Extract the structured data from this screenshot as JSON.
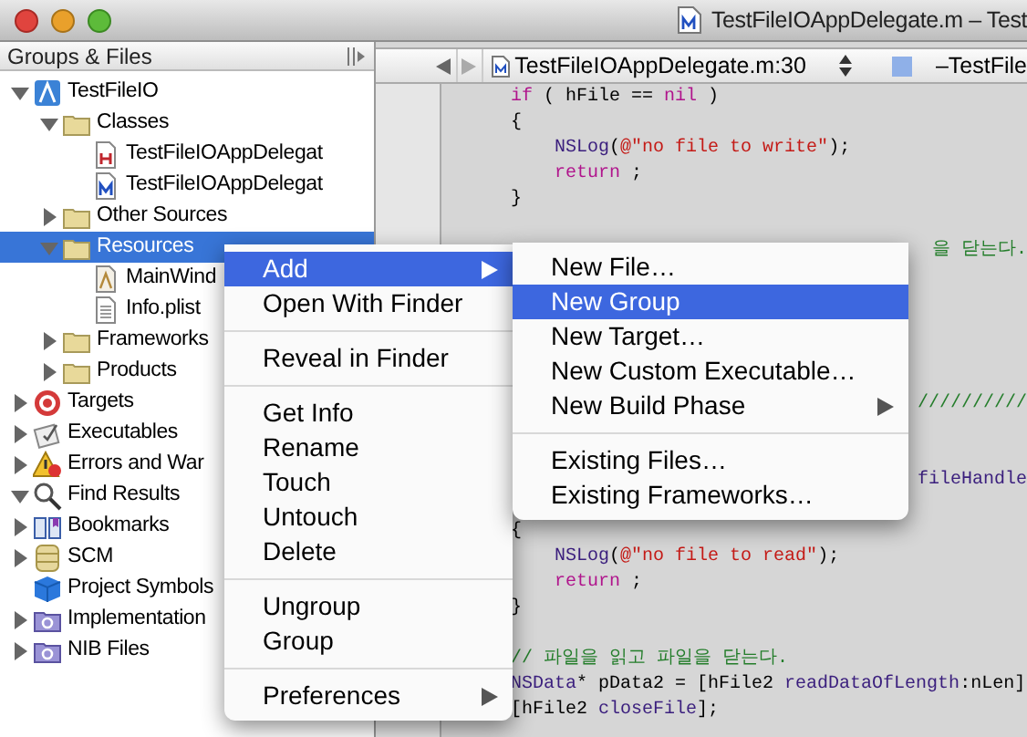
{
  "window": {
    "title": "TestFileIOAppDelegate.m – Test"
  },
  "sidebar": {
    "header": "Groups & Files",
    "items": [
      {
        "label": "TestFileIO",
        "kind": "project",
        "expanded": true,
        "selected": false,
        "children": [
          {
            "label": "Classes",
            "kind": "folder",
            "expanded": true,
            "selected": false,
            "children": [
              {
                "label": "TestFileIOAppDelegat",
                "kind": "h-file",
                "selected": false
              },
              {
                "label": "TestFileIOAppDelegat",
                "kind": "m-file",
                "selected": false
              }
            ]
          },
          {
            "label": "Other Sources",
            "kind": "folder",
            "expanded": false,
            "selected": false
          },
          {
            "label": "Resources",
            "kind": "folder",
            "expanded": true,
            "selected": true,
            "children": [
              {
                "label": "MainWind",
                "kind": "nib",
                "selected": false
              },
              {
                "label": "Info.plist",
                "kind": "plist",
                "selected": false
              }
            ]
          },
          {
            "label": "Frameworks",
            "kind": "folder",
            "expanded": false,
            "selected": false
          },
          {
            "label": "Products",
            "kind": "folder",
            "expanded": false,
            "selected": false
          }
        ]
      },
      {
        "label": "Targets",
        "kind": "target",
        "expanded": false,
        "selected": false
      },
      {
        "label": "Executables",
        "kind": "executable",
        "expanded": false,
        "selected": false
      },
      {
        "label": "Errors and War",
        "kind": "warning",
        "expanded": false,
        "selected": false
      },
      {
        "label": "Find Results",
        "kind": "find",
        "expanded": true,
        "selected": false
      },
      {
        "label": "Bookmarks",
        "kind": "bookmark",
        "expanded": false,
        "selected": false
      },
      {
        "label": "SCM",
        "kind": "scm",
        "expanded": false,
        "selected": false
      },
      {
        "label": "Project Symbols",
        "kind": "symbols",
        "selected": false
      },
      {
        "label": "Implementation",
        "kind": "smart-folder",
        "expanded": false,
        "selected": false
      },
      {
        "label": "NIB Files",
        "kind": "smart-folder",
        "expanded": false,
        "selected": false
      }
    ]
  },
  "navigation_bar": {
    "file": "TestFileIOAppDelegate.m:30",
    "symbol": "–TestFile"
  },
  "code_lines": [
    {
      "kind": "code",
      "segments": [
        {
          "kind": "keyword",
          "text": "if"
        },
        {
          "kind": "plain",
          "text": " ( hFile == "
        },
        {
          "kind": "keyword",
          "text": "nil"
        },
        {
          "kind": "plain",
          "text": " )"
        }
      ]
    },
    {
      "kind": "code",
      "segments": [
        {
          "kind": "plain",
          "text": "{"
        }
      ],
      "children": [
        {
          "kind": "code",
          "segments": [
            {
              "kind": "function",
              "text": "NSLog"
            },
            {
              "kind": "plain",
              "text": "("
            },
            {
              "kind": "string",
              "text": "@\"no file to write\""
            },
            {
              "kind": "plain",
              "text": ");"
            }
          ]
        },
        {
          "kind": "code",
          "segments": [
            {
              "kind": "keyword",
              "text": "return"
            },
            {
              "kind": "plain",
              "text": " ;"
            }
          ]
        }
      ]
    },
    {
      "kind": "code",
      "segments": [
        {
          "kind": "plain",
          "text": "}"
        }
      ]
    },
    {
      "kind": "blank"
    },
    {
      "kind": "partial",
      "segments": [
        {
          "kind": "comment",
          "text": "을 닫는다."
        }
      ]
    },
    {
      "kind": "blank"
    },
    {
      "kind": "blank"
    },
    {
      "kind": "blank"
    },
    {
      "kind": "blank"
    },
    {
      "kind": "blank"
    },
    {
      "kind": "partial",
      "segments": [
        {
          "kind": "comment",
          "text": "//////////"
        }
      ]
    },
    {
      "kind": "blank"
    },
    {
      "kind": "blank"
    },
    {
      "kind": "partial",
      "segments": [
        {
          "kind": "function",
          "text": "fileHandle"
        }
      ]
    },
    {
      "kind": "blank"
    },
    {
      "kind": "code",
      "segments": [
        {
          "kind": "plain",
          "text": "{"
        }
      ],
      "children": [
        {
          "kind": "code",
          "segments": [
            {
              "kind": "function",
              "text": "NSLog"
            },
            {
              "kind": "plain",
              "text": "("
            },
            {
              "kind": "string",
              "text": "@\"no file to read\""
            },
            {
              "kind": "plain",
              "text": ");"
            }
          ]
        },
        {
          "kind": "code",
          "segments": [
            {
              "kind": "keyword",
              "text": "return"
            },
            {
              "kind": "plain",
              "text": " ;"
            }
          ]
        }
      ]
    },
    {
      "kind": "code",
      "segments": [
        {
          "kind": "plain",
          "text": "}"
        }
      ]
    },
    {
      "kind": "blank"
    },
    {
      "kind": "code",
      "segments": [
        {
          "kind": "comment",
          "text": "// 파일을 읽고 파일을 닫는다."
        }
      ]
    },
    {
      "kind": "code",
      "segments": [
        {
          "kind": "function",
          "text": "NSData"
        },
        {
          "kind": "plain",
          "text": "* pData2 = [hFile2 "
        },
        {
          "kind": "function",
          "text": "readDataOfLength"
        },
        {
          "kind": "plain",
          "text": ":nLen]"
        }
      ]
    },
    {
      "kind": "code",
      "segments": [
        {
          "kind": "plain",
          "text": "[hFile2 "
        },
        {
          "kind": "function",
          "text": "closeFile"
        },
        {
          "kind": "plain",
          "text": "];"
        }
      ]
    }
  ],
  "context_menu": {
    "items": [
      {
        "kind": "item",
        "label": "Add",
        "selected": true,
        "submenu": true
      },
      {
        "kind": "item",
        "label": "Open With Finder",
        "selected": false,
        "submenu": false
      },
      {
        "kind": "separator"
      },
      {
        "kind": "item",
        "label": "Reveal in Finder",
        "selected": false,
        "submenu": false
      },
      {
        "kind": "separator"
      },
      {
        "kind": "item",
        "label": "Get Info",
        "selected": false,
        "submenu": false
      },
      {
        "kind": "item",
        "label": "Rename",
        "selected": false,
        "submenu": false
      },
      {
        "kind": "item",
        "label": "Touch",
        "selected": false,
        "submenu": false
      },
      {
        "kind": "item",
        "label": "Untouch",
        "selected": false,
        "submenu": false
      },
      {
        "kind": "item",
        "label": "Delete",
        "selected": false,
        "submenu": false
      },
      {
        "kind": "separator"
      },
      {
        "kind": "item",
        "label": "Ungroup",
        "selected": false,
        "submenu": false
      },
      {
        "kind": "item",
        "label": "Group",
        "selected": false,
        "submenu": false
      },
      {
        "kind": "separator"
      },
      {
        "kind": "item",
        "label": "Preferences",
        "selected": false,
        "submenu": true
      }
    ]
  },
  "submenu": {
    "items": [
      {
        "kind": "item",
        "label": "New File…",
        "selected": false,
        "submenu": false
      },
      {
        "kind": "item",
        "label": "New Group",
        "selected": true,
        "submenu": false
      },
      {
        "kind": "item",
        "label": "New Target…",
        "selected": false,
        "submenu": false
      },
      {
        "kind": "item",
        "label": "New Custom Executable…",
        "selected": false,
        "submenu": false
      },
      {
        "kind": "item",
        "label": "New Build Phase",
        "selected": false,
        "submenu": true
      },
      {
        "kind": "separator"
      },
      {
        "kind": "item",
        "label": "Existing Files…",
        "selected": false,
        "submenu": false
      },
      {
        "kind": "item",
        "label": "Existing Frameworks…",
        "selected": false,
        "submenu": false
      }
    ]
  }
}
